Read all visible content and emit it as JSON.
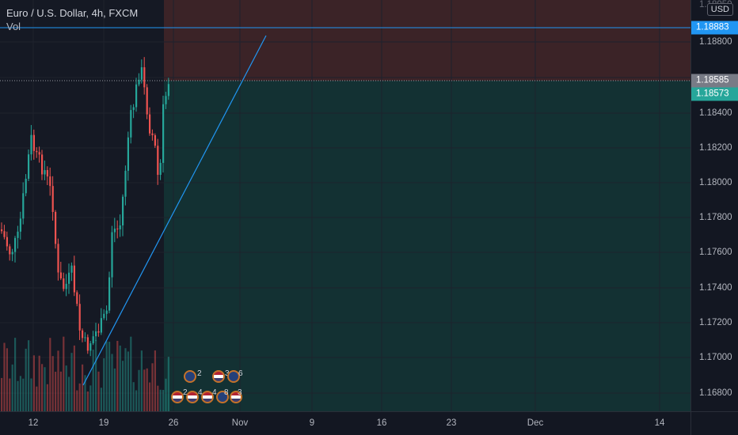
{
  "legend": {
    "symbol_line": "Euro / U.S. Dollar, 4h, FXCM",
    "volume_label": "Vol"
  },
  "price_scale": {
    "currency": "USD",
    "ticks": [
      "1.18800",
      "1.18400",
      "1.18200",
      "1.18000",
      "1.17800",
      "1.17600",
      "1.17400",
      "1.17200",
      "1.17000",
      "1.16800"
    ],
    "top_clipped_label": "1.18950"
  },
  "price_tags": {
    "horizontal_line": "1.18883",
    "last_price": "1.18585",
    "entry_price": "1.18573"
  },
  "time_scale": {
    "ticks": [
      "12",
      "19",
      "26",
      "Nov",
      "9",
      "16",
      "23",
      "Dec",
      "14"
    ]
  },
  "events": {
    "row1": [
      {
        "flag": "eu",
        "count": "2"
      },
      {
        "flag": "us",
        "count": "3"
      },
      {
        "flag": "eu",
        "count": "6"
      }
    ],
    "row2": [
      {
        "flag": "us",
        "count": "2"
      },
      {
        "flag": "us",
        "count": "4"
      },
      {
        "flag": "us",
        "count": "4"
      },
      {
        "flag": "eu",
        "count": "8"
      },
      {
        "flag": "us",
        "count": "3"
      }
    ]
  },
  "colors": {
    "background": "#131722",
    "bull": "#26a69a",
    "bear": "#ef5350",
    "stop_zone": "#3b2327",
    "target_zone": "#133133",
    "trendline": "#2196f3",
    "horizontal_line": "#2196f3",
    "last_price_tag": "#787b86",
    "entry_tag": "#26a69a",
    "arrow": "#ef5350"
  },
  "icons": {
    "short_signal": "down-arrow-icon"
  }
}
